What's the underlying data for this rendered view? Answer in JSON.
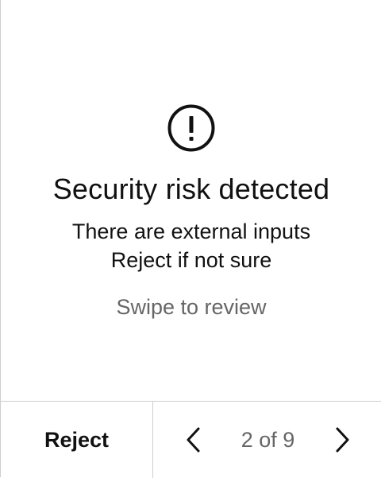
{
  "warning": {
    "icon": "exclamation-circle-icon",
    "title": "Security risk detected",
    "message_lines": [
      "There are external inputs",
      "Reject if not sure"
    ],
    "hint": "Swipe to review"
  },
  "footer": {
    "reject_label": "Reject",
    "pager_text": "2 of 9",
    "prev_icon": "chevron-left-icon",
    "next_icon": "chevron-right-icon"
  },
  "colors": {
    "text": "#111111",
    "muted": "#666666",
    "divider": "#cfcfcf",
    "background": "#ffffff"
  }
}
